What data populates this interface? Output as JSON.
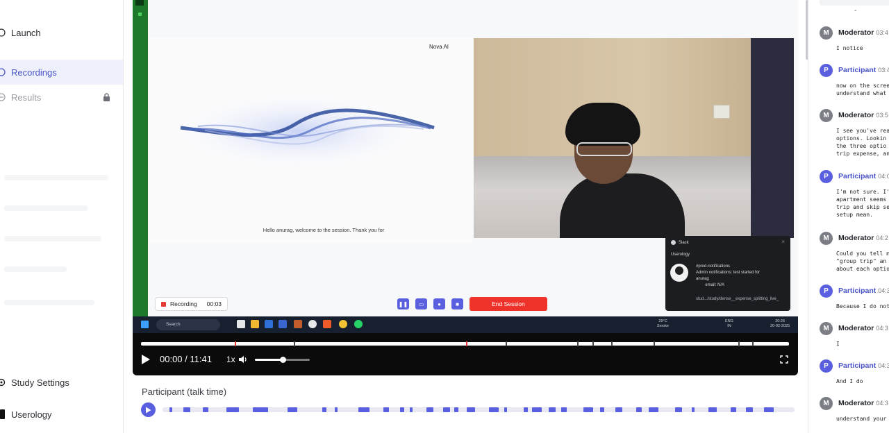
{
  "sidebar": {
    "nav": [
      {
        "label": "Launch",
        "icon": "rocket-icon",
        "state": "normal"
      },
      {
        "label": "Recordings",
        "icon": "record-icon",
        "state": "active"
      },
      {
        "label": "Results",
        "icon": "chart-icon",
        "state": "disabled"
      }
    ],
    "study_settings": "Study Settings",
    "org_name": "Userology"
  },
  "screen": {
    "ai_label": "Nova AI",
    "caption": "Hello anurag, welcome to the session. Thank you for",
    "recording_label": "Recording",
    "recording_time": "00:03",
    "end_session": "End Session",
    "taskbar_search": "Search",
    "taskbar_weather": "29°C\nSmoke",
    "taskbar_lang": "ENG\nIN",
    "taskbar_clock": "20:26\n20-02-2025"
  },
  "slack": {
    "app": "Slack",
    "org": "Userology",
    "body": "#prod-notifications\nAdmin notifications: test started for\nanurag\n        email: N/A",
    "link": "stud.../study/dense__expense_splitting_live_"
  },
  "player": {
    "time": "00:00 / 11:41",
    "speed": "1x",
    "volume": 0.5,
    "accent": "#5a5fe0"
  },
  "talk": {
    "label": "Participant (talk time)"
  },
  "transcript": {
    "entries": [
      {
        "role": "mod",
        "initial": "M",
        "name": "Moderator",
        "time": "03:4",
        "text": "I notice"
      },
      {
        "role": "par",
        "initial": "P",
        "name": "Participant",
        "time": "03:4",
        "text": "now on the scree\nunderstand what"
      },
      {
        "role": "mod",
        "initial": "M",
        "name": "Moderator",
        "time": "03:5",
        "text": "I see you've rea\noptions. Lookin\nthe three optio\ntrip expense, an"
      },
      {
        "role": "par",
        "initial": "P",
        "name": "Participant",
        "time": "04:0",
        "text": "I'm not sure. I'\napartment seems\ntrip and skip se\nsetup mean."
      },
      {
        "role": "mod",
        "initial": "M",
        "name": "Moderator",
        "time": "04:2",
        "text": "Could you tell m\n\"group trip\" an\nabout each optio"
      },
      {
        "role": "par",
        "initial": "P",
        "name": "Participant",
        "time": "04:3",
        "text": "Because I do not"
      },
      {
        "role": "mod",
        "initial": "M",
        "name": "Moderator",
        "time": "04:3",
        "text": "I"
      },
      {
        "role": "par",
        "initial": "P",
        "name": "Participant",
        "time": "04:3",
        "text": "And I do"
      },
      {
        "role": "mod",
        "initial": "M",
        "name": "Moderator",
        "time": "04:3",
        "text": "understand your"
      }
    ]
  }
}
